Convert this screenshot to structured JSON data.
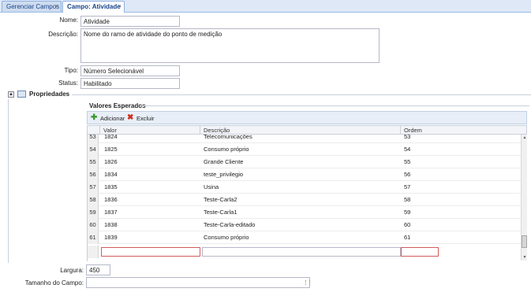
{
  "tabs": [
    {
      "label": "Gerenciar Campos",
      "close": "×"
    },
    {
      "label": "Campo: Atividade",
      "close": "×"
    }
  ],
  "form": {
    "nome_label": "Nome:",
    "nome_value": "Atividade",
    "descricao_label": "Descrição:",
    "descricao_value": "Nome do ramo de atividade do ponto de medição",
    "tipo_label": "Tipo:",
    "tipo_value": "Número Selecionável",
    "status_label": "Status:",
    "status_value": "Habilitado"
  },
  "propriedades": {
    "title": "Propriedades",
    "collapse_glyph": "▲",
    "valores_title": "Valores Esperados",
    "toolbar": {
      "add_label": "Adicionar",
      "delete_label": "Excluir"
    },
    "columns": [
      "Valor",
      "Descrição",
      "Ordem"
    ],
    "rows": [
      {
        "n": "53",
        "valor": "1824",
        "descricao": "Telecomunicações",
        "ordem": "53"
      },
      {
        "n": "54",
        "valor": "1825",
        "descricao": "Consumo próprio",
        "ordem": "54"
      },
      {
        "n": "55",
        "valor": "1826",
        "descricao": "Grande Cliente",
        "ordem": "55"
      },
      {
        "n": "56",
        "valor": "1834",
        "descricao": "teste_privilegio",
        "ordem": "56"
      },
      {
        "n": "57",
        "valor": "1835",
        "descricao": "Usina",
        "ordem": "57"
      },
      {
        "n": "58",
        "valor": "1836",
        "descricao": "Teste-Carla2",
        "ordem": "58"
      },
      {
        "n": "59",
        "valor": "1837",
        "descricao": "Teste-Carla1",
        "ordem": "59"
      },
      {
        "n": "60",
        "valor": "1838",
        "descricao": "Teste-Carla-editado",
        "ordem": "60"
      },
      {
        "n": "61",
        "valor": "1839",
        "descricao": "Consumo próprio",
        "ordem": "61"
      }
    ],
    "largura_label": "Largura:",
    "largura_value": "450",
    "tamanho_label": "Tamanho do Campo:",
    "tamanho_value": ""
  },
  "colors": {
    "tab_bg": "#dfe8f6",
    "invalid_border": "#d45b5b",
    "add_icon": "#3a9a2a",
    "delete_icon": "#d02a1a"
  },
  "icons": {
    "add": "plus-icon",
    "delete": "x-icon"
  }
}
